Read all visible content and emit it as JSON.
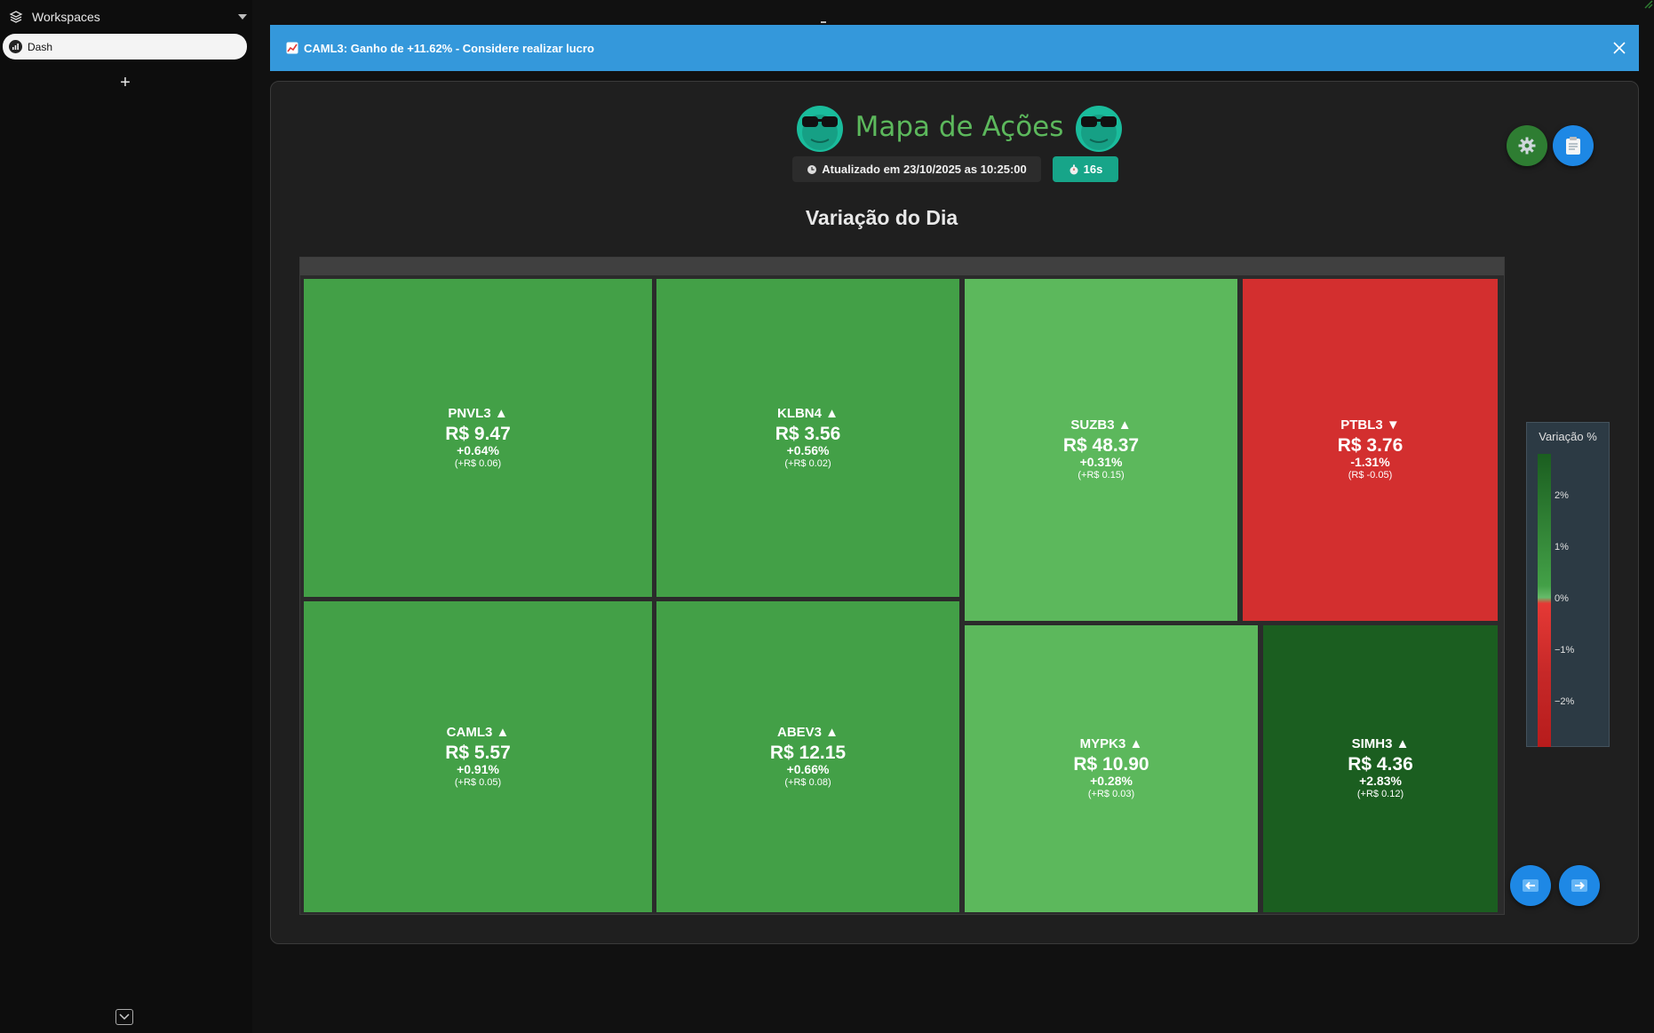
{
  "sidebar": {
    "title": "Workspaces",
    "items": [
      {
        "label": "Dash"
      }
    ],
    "add_label": "+"
  },
  "notification": {
    "text": "CAML3: Ganho de +11.62% - Considere realizar lucro",
    "color": "#3498db"
  },
  "header": {
    "title": "Mapa de Ações",
    "updated": "Atualizado em 23/10/2025 as 10:25:00",
    "timer": "16s"
  },
  "section": {
    "title": "Variação do Dia"
  },
  "colors": {
    "strong_up": "#1b5e20",
    "up": "#43a047",
    "mild_up": "#5cb85c",
    "down": "#d32f2f"
  },
  "tiles": [
    {
      "ticker": "PNVL3 ▲",
      "price": "R$ 9.47",
      "pct": "+0.64%",
      "diff": "(+R$ 0.06)"
    },
    {
      "ticker": "KLBN4 ▲",
      "price": "R$ 3.56",
      "pct": "+0.56%",
      "diff": "(+R$ 0.02)"
    },
    {
      "ticker": "SUZB3 ▲",
      "price": "R$ 48.37",
      "pct": "+0.31%",
      "diff": "(+R$ 0.15)"
    },
    {
      "ticker": "PTBL3 ▼",
      "price": "R$ 3.76",
      "pct": "-1.31%",
      "diff": "(R$ -0.05)"
    },
    {
      "ticker": "CAML3 ▲",
      "price": "R$ 5.57",
      "pct": "+0.91%",
      "diff": "(+R$ 0.05)"
    },
    {
      "ticker": "ABEV3 ▲",
      "price": "R$ 12.15",
      "pct": "+0.66%",
      "diff": "(+R$ 0.08)"
    },
    {
      "ticker": "MYPK3 ▲",
      "price": "R$ 10.90",
      "pct": "+0.28%",
      "diff": "(+R$ 0.03)"
    },
    {
      "ticker": "SIMH3 ▲",
      "price": "R$ 4.36",
      "pct": "+2.83%",
      "diff": "(+R$ 0.12)"
    }
  ],
  "legend": {
    "title": "Variação %",
    "ticks": [
      "2%",
      "1%",
      "0%",
      "−1%",
      "−2%"
    ]
  }
}
